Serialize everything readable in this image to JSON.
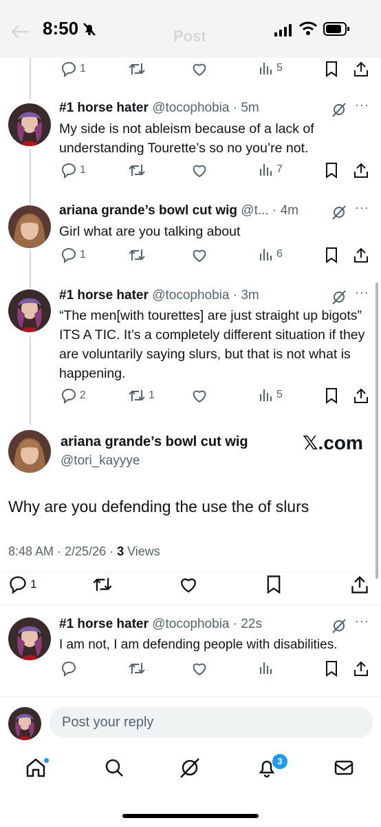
{
  "status_bar": {
    "time": "8:50",
    "ghost_title": "Post"
  },
  "tweets": [
    {
      "name": "#1 horse hater",
      "handle": "@tocophobia",
      "time": "5m",
      "text": "My side is not ableism because of a lack of understanding Tourette’s so no you’re not.",
      "replies": "1",
      "reposts": "",
      "views": "7"
    },
    {
      "name": "ariana grande’s bowl cut wig",
      "handle": "@t...",
      "time": "4m",
      "text": "Girl what are you talking about",
      "replies": "1",
      "reposts": "",
      "views": "6"
    },
    {
      "name": "#1 horse hater",
      "handle": "@tocophobia",
      "time": "3m",
      "text": "“The men[with tourettes] are just straight up bigots” ITS A TIC. It’s a completely different situation if they are voluntarily saying slurs, but that is not what is happening.",
      "replies": "2",
      "reposts": "1",
      "views": "5"
    },
    {
      "name": "#1 horse hater",
      "handle": "@tocophobia",
      "time": "22s",
      "text": "I am not, I am defending people with disabilities.",
      "replies": "",
      "reposts": "",
      "views": ""
    }
  ],
  "top_actions": {
    "replies": "1",
    "views": "5"
  },
  "main_post": {
    "name": "ariana grande’s bowl cut wig",
    "handle": "@tori_kayyye",
    "watermark": "𝕏.com",
    "text": "Why are you defending the use the of slurs",
    "timestamp": "8:48 AM · 2/25/26 · ",
    "views_count": "3",
    "views_label": " Views",
    "replies": "1"
  },
  "reply_input": {
    "placeholder": "Post your reply"
  },
  "tab_bar": {
    "notifications_badge": "3"
  },
  "colors": {
    "accent": "#1d9bf0",
    "text": "#0f1419",
    "secondary": "#536471"
  },
  "icons": [
    "home-icon",
    "search-icon",
    "grok-icon",
    "bell-icon",
    "mail-icon",
    "reply-icon",
    "repost-icon",
    "like-icon",
    "views-icon",
    "bookmark-icon",
    "share-icon"
  ]
}
